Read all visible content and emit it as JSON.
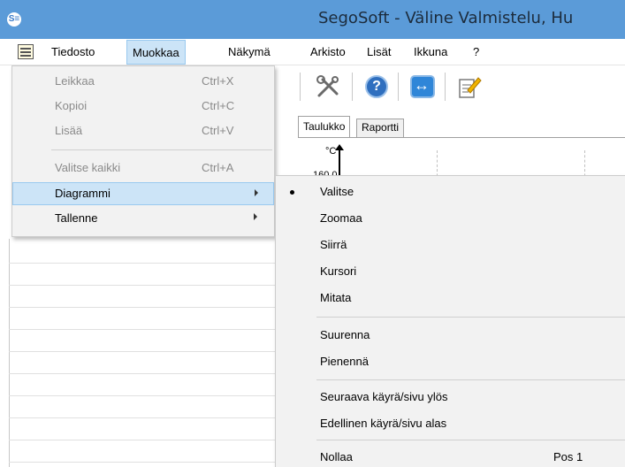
{
  "window": {
    "title": "SegoSoft - Väline Valmistelu, Hu",
    "icon_label": "S≡"
  },
  "menubar": {
    "items": [
      "Tiedosto",
      "Muokkaa",
      "Näkymä",
      "Arkisto",
      "Lisät",
      "Ikkuna",
      "?"
    ],
    "active": "Muokkaa"
  },
  "edit_menu": {
    "items": [
      {
        "label": "Leikkaa",
        "shortcut": "Ctrl+X",
        "enabled": false
      },
      {
        "label": "Kopioi",
        "shortcut": "Ctrl+C",
        "enabled": false
      },
      {
        "label": "Lisää",
        "shortcut": "Ctrl+V",
        "enabled": false
      },
      {
        "label": "Valitse kaikki",
        "shortcut": "Ctrl+A",
        "enabled": false
      },
      {
        "label": "Diagrammi",
        "submenu": true,
        "highlighted": true
      },
      {
        "label": "Tallenne",
        "submenu": true
      }
    ]
  },
  "diagram_submenu": {
    "items": [
      {
        "label": "Valitse",
        "checked": true
      },
      {
        "label": "Zoomaa"
      },
      {
        "label": "Siirrä"
      },
      {
        "label": "Kursori"
      },
      {
        "label": "Mitata"
      },
      {
        "label": "Suurenna"
      },
      {
        "label": "Pienennä"
      },
      {
        "label": "Seuraava käyrä/sivu ylös"
      },
      {
        "label": "Edellinen käyrä/sivu alas"
      },
      {
        "label": "Nollaa",
        "shortcut": "Pos 1"
      }
    ]
  },
  "tabs": [
    "Taulukko",
    "Raportti"
  ],
  "chart": {
    "y_unit": "°C",
    "y_tick": "160.0"
  },
  "colors": {
    "titlebar": "#5b9bd8",
    "menu_highlight": "#cce4f7",
    "menu_bg": "#f2f2f2"
  },
  "toolbar_icons": [
    "tools-icon",
    "help-icon",
    "sync-icon",
    "edit-note-icon"
  ]
}
